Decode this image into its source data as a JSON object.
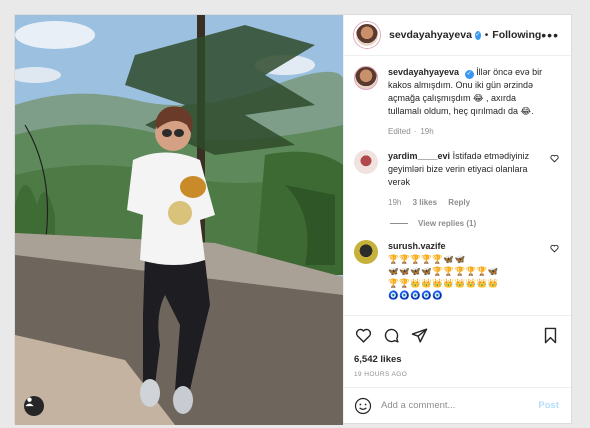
{
  "header": {
    "username": "sevdayahyayeva",
    "separator": "•",
    "follow_status": "Following",
    "more": "•••"
  },
  "caption": {
    "username": "sevdayahyayeva",
    "text": "İllər öncə evə bir kakos almışdım. Onu iki gün ərzində açmağa çalışmışdım 😂 , axırda tullamalı oldum, heç qırılmadı da 😂.",
    "edited": "Edited",
    "time": "19h"
  },
  "comments": [
    {
      "username": "yardim____evi",
      "text": "İstifadə etmədiyiniz geyimləri bize verin etiyaci olanlara verək",
      "time": "19h",
      "likes": "3 likes",
      "reply": "Reply",
      "view_replies": "View replies (1)"
    },
    {
      "username": "surush.vazife",
      "emoji_line1": "🏆🏆🏆🏆🏆🦋🦋",
      "emoji_line2": "🦋🦋🦋🦋🏆🏆🏆🏆🏆🦋",
      "emoji_line3": "🏆🏆👑👑👑👑👑👑👑👑",
      "emoji_line4": "🧿🧿🧿🧿🧿"
    }
  ],
  "actions": {
    "likes": "6,542 likes",
    "time": "19 HOURS AGO"
  },
  "add_comment": {
    "placeholder": "Add a comment...",
    "post_label": "Post"
  },
  "colors": {
    "verified": "#3897f0",
    "post_disabled": "#b2dffc",
    "muted": "#8e8e8e"
  }
}
